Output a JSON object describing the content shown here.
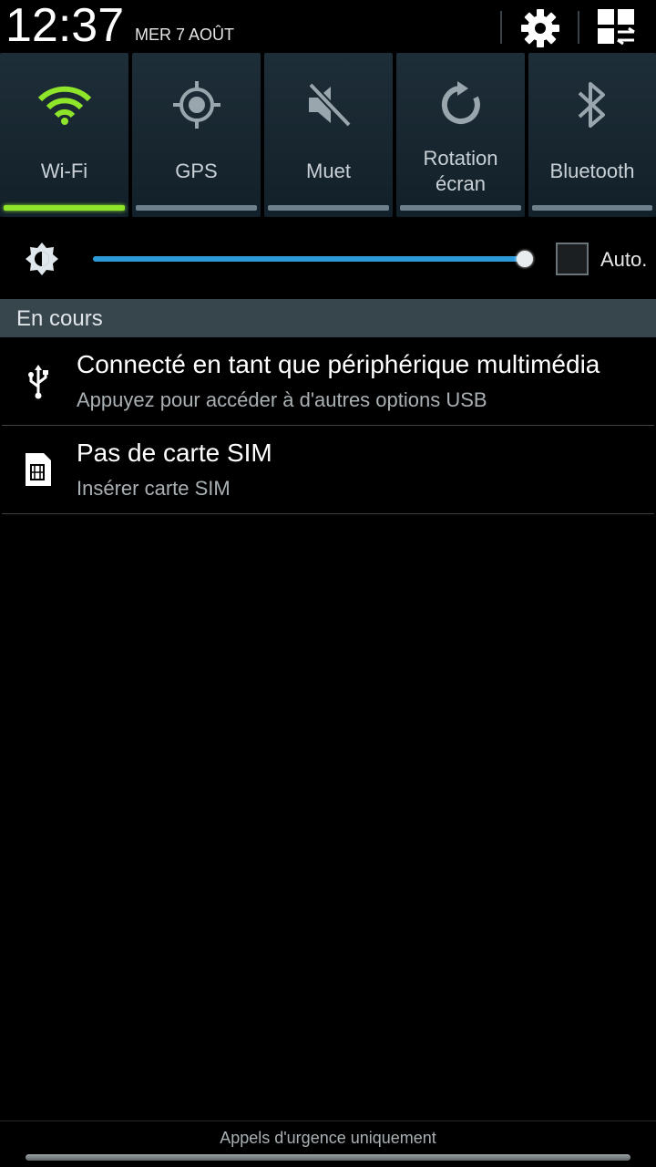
{
  "header": {
    "time": "12:37",
    "date": "MER 7 AOÛT",
    "settings_icon": "gear-icon",
    "toggle_grid_icon": "quick-settings-grid-icon"
  },
  "quick_toggles": [
    {
      "label": "Wi-Fi",
      "icon": "wifi-icon",
      "active": true
    },
    {
      "label": "GPS",
      "icon": "gps-icon",
      "active": false
    },
    {
      "label": "Muet",
      "icon": "mute-icon",
      "active": false
    },
    {
      "label_line1": "Rotation",
      "label_line2": "écran",
      "icon": "rotation-icon",
      "active": false
    },
    {
      "label": "Bluetooth",
      "icon": "bluetooth-icon",
      "active": false
    }
  ],
  "brightness": {
    "icon": "brightness-icon",
    "level": 0.995,
    "auto_label": "Auto.",
    "auto_checked": false
  },
  "ongoing": {
    "section_title": "En cours",
    "items": [
      {
        "icon": "usb-icon",
        "title": "Connecté en tant que périphérique multimédia",
        "subtitle": "Appuyez pour accéder à d'autres options USB"
      },
      {
        "icon": "sim-card-icon",
        "title": "Pas de carte SIM",
        "subtitle": "Insérer carte SIM"
      }
    ]
  },
  "footer": {
    "carrier_text": "Appels d'urgence uniquement"
  },
  "colors": {
    "active_toggle": "#8ee52a",
    "slider_fill": "#2d9ad8",
    "section_header": "#37454d"
  }
}
